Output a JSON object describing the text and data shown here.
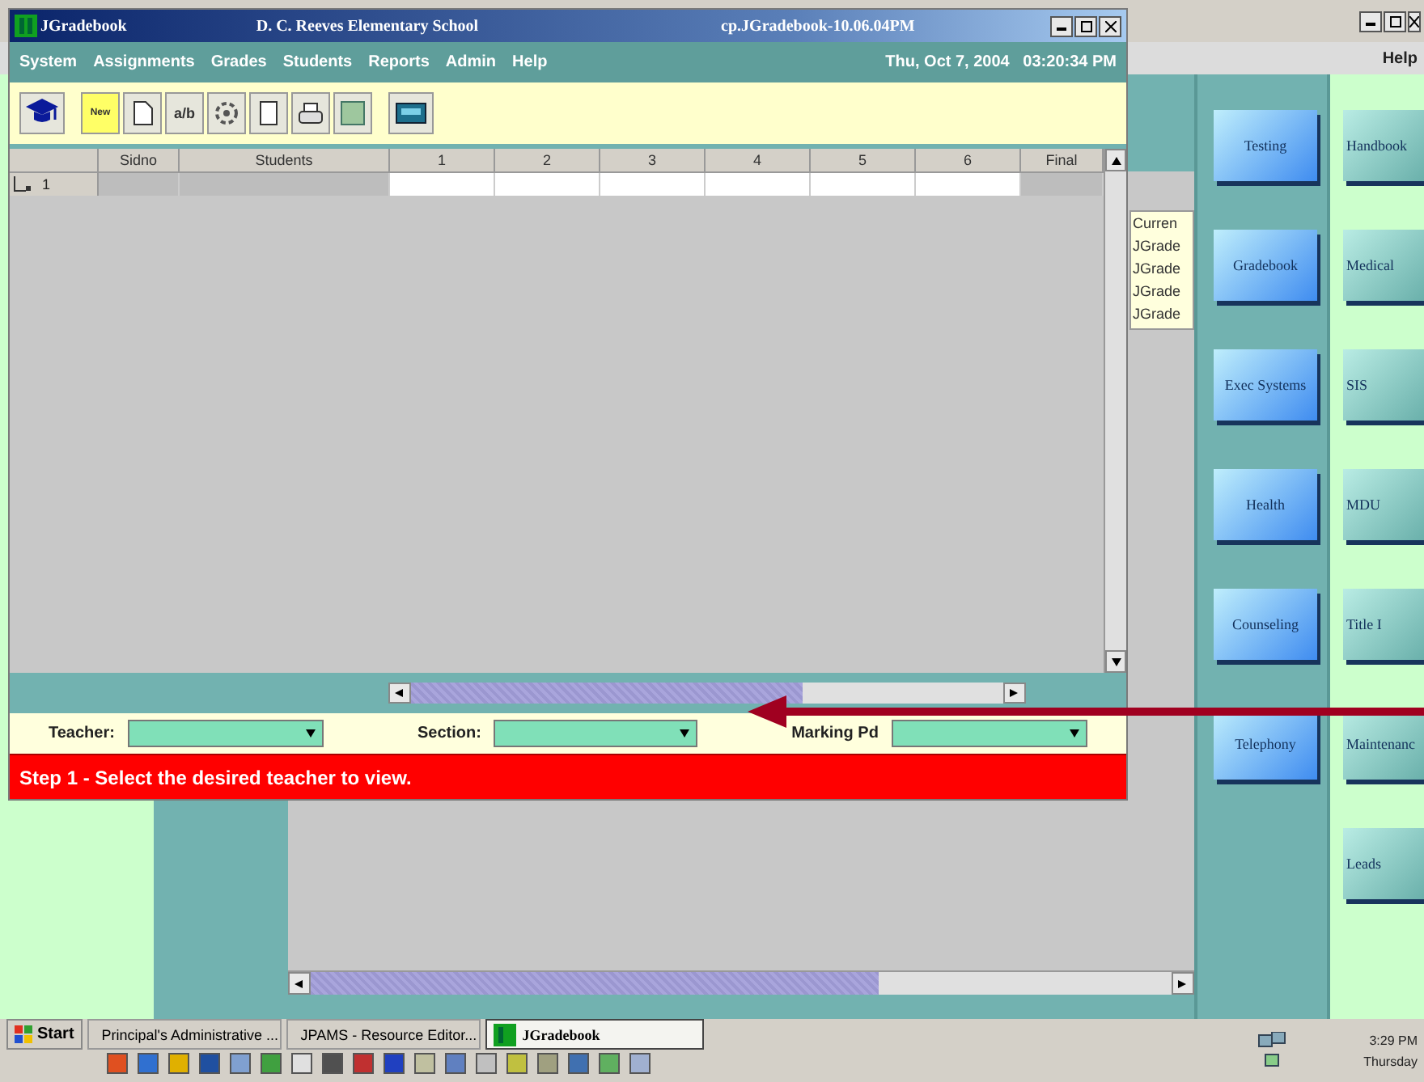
{
  "back_window": {
    "menu": [
      "Help"
    ],
    "list": [
      "Curren",
      "JGrade",
      "JGrade",
      "JGrade",
      "JGrade"
    ],
    "left_buttons": [
      "Testing",
      "Gradebook",
      "Exec Systems",
      "Health",
      "Counseling",
      "Telephony"
    ],
    "right_buttons": [
      "Handbook",
      "Medical",
      "SIS",
      "MDU",
      "Title I",
      "Maintenanc",
      "Leads"
    ]
  },
  "window": {
    "title": "JGradebook",
    "school": "D. C. Reeves Elementary School",
    "session": "cp.JGradebook-10.06.04PM",
    "menu": [
      "System",
      "Assignments",
      "Grades",
      "Students",
      "Reports",
      "Admin",
      "Help"
    ],
    "datetime": "Thu, Oct 7, 2004   03:20:34 PM"
  },
  "toolbar": [
    {
      "kind": "cap"
    },
    {
      "kind": "new",
      "label": "New"
    },
    {
      "kind": "document"
    },
    {
      "kind": "fraction",
      "label": "a/b"
    },
    {
      "kind": "gear"
    },
    {
      "kind": "page"
    },
    {
      "kind": "printer"
    },
    {
      "kind": "grid"
    },
    {
      "kind": "monitor"
    }
  ],
  "grid": {
    "columns": [
      "Sidno",
      "Students",
      "1",
      "2",
      "3",
      "4",
      "5",
      "6",
      "Final"
    ],
    "rows": [
      {
        "number": "1"
      }
    ]
  },
  "filters": [
    {
      "label": "Teacher:"
    },
    {
      "label": "Section:"
    },
    {
      "label": "Marking Pd"
    }
  ],
  "status": "Step 1 - Select the desired teacher to view.",
  "taskbar": {
    "start": "Start",
    "tasks": [
      {
        "label": "Principal's Administrative ...",
        "selected": false,
        "kind": "doc"
      },
      {
        "label": "JPAMS - Resource Editor...",
        "selected": false,
        "kind": "doc"
      },
      {
        "label": "JGradebook",
        "selected": true,
        "kind": "app"
      }
    ],
    "clock": "3:29 PM",
    "day": "Thursday"
  }
}
